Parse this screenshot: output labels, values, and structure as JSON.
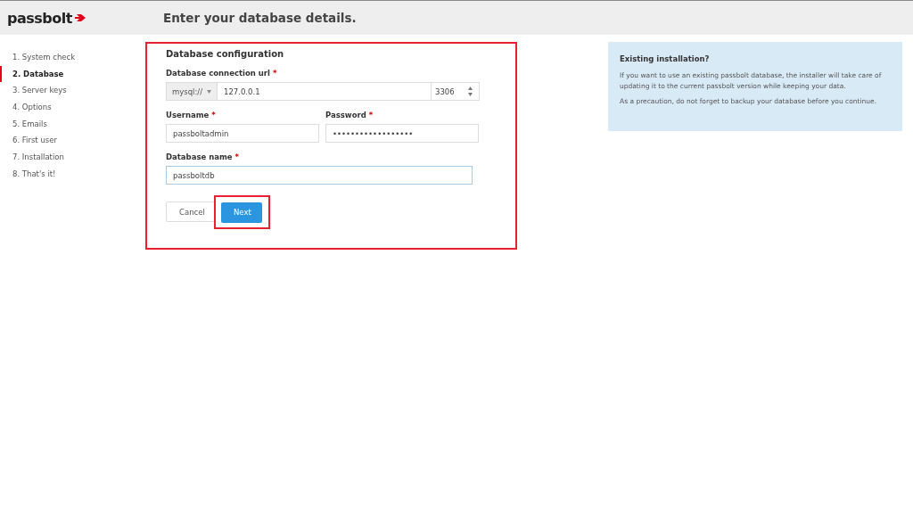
{
  "header": {
    "logo": "passbolt",
    "title": "Enter your database details."
  },
  "steps": [
    {
      "label": "1. System check",
      "selected": false
    },
    {
      "label": "2. Database",
      "selected": true
    },
    {
      "label": "3. Server keys",
      "selected": false
    },
    {
      "label": "4. Options",
      "selected": false
    },
    {
      "label": "5. Emails",
      "selected": false
    },
    {
      "label": "6. First user",
      "selected": false
    },
    {
      "label": "7. Installation",
      "selected": false
    },
    {
      "label": "8. That's it!",
      "selected": false
    }
  ],
  "form": {
    "title": "Database configuration",
    "connection": {
      "label": "Database connection url",
      "required": "*",
      "scheme": "mysql://",
      "host": "127.0.0.1",
      "port": "3306"
    },
    "username": {
      "label": "Username",
      "required": "*",
      "value": "passboltadmin"
    },
    "password": {
      "label": "Password",
      "required": "*",
      "value": "••••••••••••••••••"
    },
    "database": {
      "label": "Database name",
      "required": "*",
      "value": "passboltdb",
      "focused": true
    },
    "buttons": [
      {
        "label": "Cancel",
        "kind": "secondary",
        "highlighted": false
      },
      {
        "label": "Next",
        "kind": "primary",
        "highlighted": true
      }
    ]
  },
  "info": {
    "title": "Existing installation?",
    "paragraphs": [
      "If you want to use an existing passbolt database, the installer will take care of updating it to the current passbolt version while keeping your data.",
      "As a precaution, do not forget to backup your database before you continue."
    ]
  }
}
